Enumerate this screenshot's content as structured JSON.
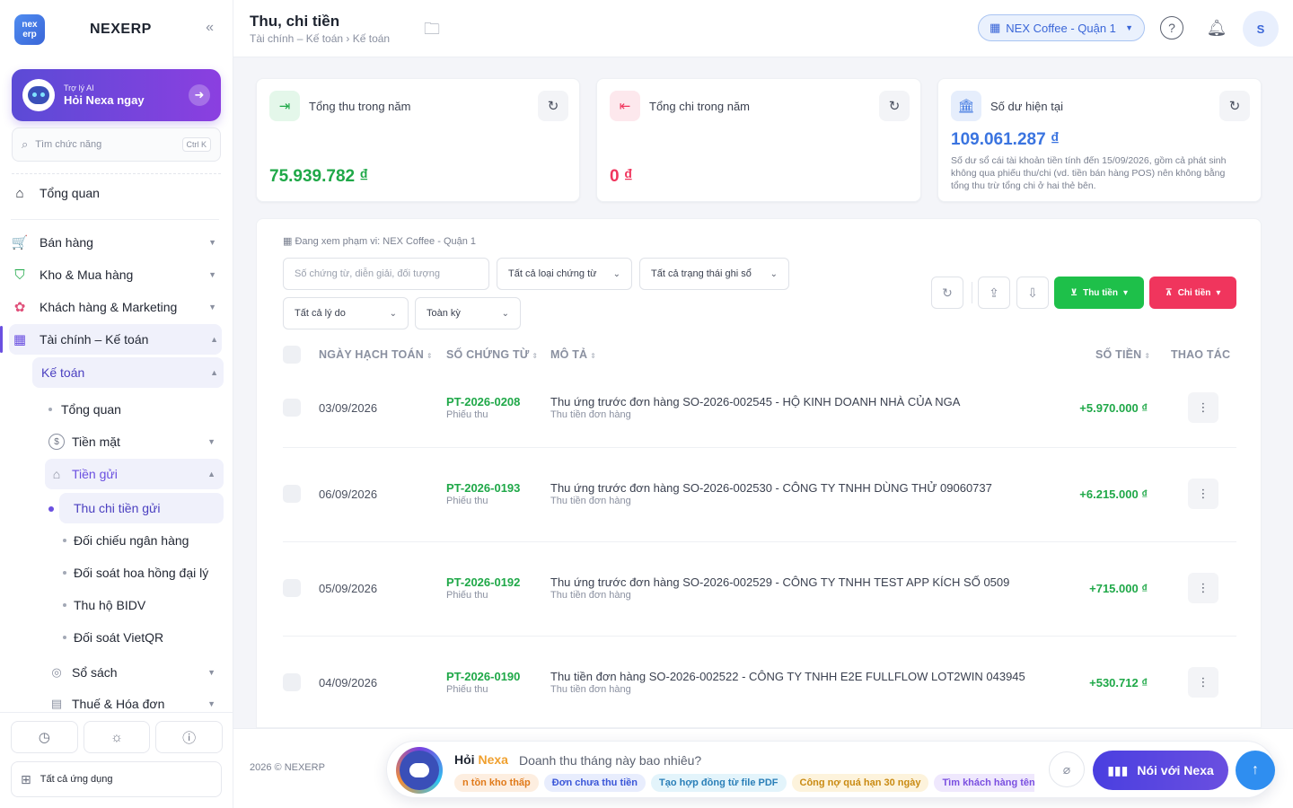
{
  "brand": {
    "logo_text": "nex erp",
    "name": "NEXERP",
    "collapse_icon": "double-chevron-left-icon"
  },
  "ai_card": {
    "subtitle": "Trợ lý AI",
    "title": "Hỏi Nexa ngay"
  },
  "search": {
    "placeholder": "Tìm chức năng",
    "shortcut": "Ctrl K"
  },
  "sidebar": {
    "top": {
      "label": "Tổng quan"
    },
    "groups": [
      {
        "label": "Bán hàng"
      },
      {
        "label": "Kho & Mua hàng"
      },
      {
        "label": "Khách hàng & Marketing"
      },
      {
        "label": "Tài chính – Kế toán"
      }
    ],
    "ketoan": {
      "label": "Kế toán"
    },
    "ketoan_items": {
      "overview": "Tổng quan",
      "cash": "Tiền mặt",
      "deposit": "Tiền gửi",
      "deposit_children": [
        "Thu chi tiền gửi",
        "Đối chiếu ngân hàng",
        "Đối soát hoa hồng đại lý",
        "Thu hộ BIDV",
        "Đối soát VietQR"
      ],
      "books": "Sổ sách",
      "tax": "Thuế & Hóa đơn"
    },
    "all_apps": "Tất cả ứng dụng"
  },
  "header": {
    "title": "Thu, chi tiền",
    "breadcrumb": "Tài chính – Kế toán › Kế toán",
    "branch": "NEX Coffee - Quận 1",
    "avatar": "S"
  },
  "stats": [
    {
      "label": "Tổng thu trong năm",
      "value": "75.939.782 ₫",
      "color": "#1fa848"
    },
    {
      "label": "Tổng chi trong năm",
      "value": "0 ₫",
      "color": "#f0355d"
    },
    {
      "label": "Số dư hiện tại",
      "value": "109.061.287 ₫",
      "color": "#3a74e0",
      "note": "Số dư sổ cái tài khoản tiền tính đến 15/09/2026, gồm cả phát sinh không qua phiếu thu/chi (vd. tiền bán hàng POS) nên không bằng tổng thu trừ tổng chi ở hai thẻ bên."
    }
  ],
  "filters": {
    "scope": "Đang xem phạm vi: NEX Coffee - Quận 1",
    "search_placeholder": "Số chứng từ, diễn giải, đối tượng",
    "voucher_type": "Tất cả loại chứng từ",
    "posting_status": "Tất cả trạng thái ghi sổ",
    "reason": "Tất cả lý do",
    "period": "Toàn kỳ",
    "receive_btn": "Thu tiền",
    "pay_btn": "Chi tiền"
  },
  "table": {
    "columns": {
      "date": "NGÀY HẠCH TOÁN",
      "code": "SỐ CHỨNG TỪ",
      "desc": "MÔ TẢ",
      "amount": "SỐ TIỀN",
      "actions": "THAO TÁC"
    },
    "rows": [
      {
        "date": "03/09/2026",
        "code": "PT-2026-0208",
        "type": "Phiếu thu",
        "desc": "Thu ứng trước đơn hàng SO-2026-002545 - HỘ KINH DOANH NHÀ CỦA NGA",
        "sub": "Thu tiền đơn hàng",
        "amount": "+5.970.000 ₫"
      },
      {
        "date": "06/09/2026",
        "code": "PT-2026-0193",
        "type": "Phiếu thu",
        "desc": "Thu ứng trước đơn hàng SO-2026-002530 - CÔNG TY TNHH DÙNG THỬ 09060737",
        "sub": "Thu tiền đơn hàng",
        "amount": "+6.215.000 ₫"
      },
      {
        "date": "05/09/2026",
        "code": "PT-2026-0192",
        "type": "Phiếu thu",
        "desc": "Thu ứng trước đơn hàng SO-2026-002529 - CÔNG TY TNHH TEST APP KÍCH SỐ 0509",
        "sub": "Thu tiền đơn hàng",
        "amount": "+715.000 ₫"
      },
      {
        "date": "04/09/2026",
        "code": "PT-2026-0190",
        "type": "Phiếu thu",
        "desc": "Thu tiền đơn hàng SO-2026-002522 - CÔNG TY TNHH E2E FULLFLOW LOT2WIN 043945",
        "sub": "Thu tiền đơn hàng",
        "amount": "+530.712 ₫"
      }
    ]
  },
  "footer": {
    "copyright": "2026 © NEXERP",
    "ask_prefix": "Hỏi",
    "ask_brand": "Nexa",
    "ask_question": "Doanh thu tháng này bao nhiêu?",
    "chips": [
      {
        "label": "n tồn kho thấp",
        "bg": "#fdeee0",
        "fg": "#e07a1a"
      },
      {
        "label": "Đơn chưa thu tiền",
        "bg": "#e8edfd",
        "fg": "#3a56d8"
      },
      {
        "label": "Tạo hợp đồng từ file PDF",
        "bg": "#e3f4fb",
        "fg": "#2a7fb8"
      },
      {
        "label": "Công nợ quá hạn 30 ngày",
        "bg": "#fdf3dc",
        "fg": "#c98a12"
      },
      {
        "label": "Tìm khách hàng tên",
        "bg": "#efe8fd",
        "fg": "#7a4fe0"
      }
    ],
    "talk_btn": "Nói với Nexa"
  }
}
